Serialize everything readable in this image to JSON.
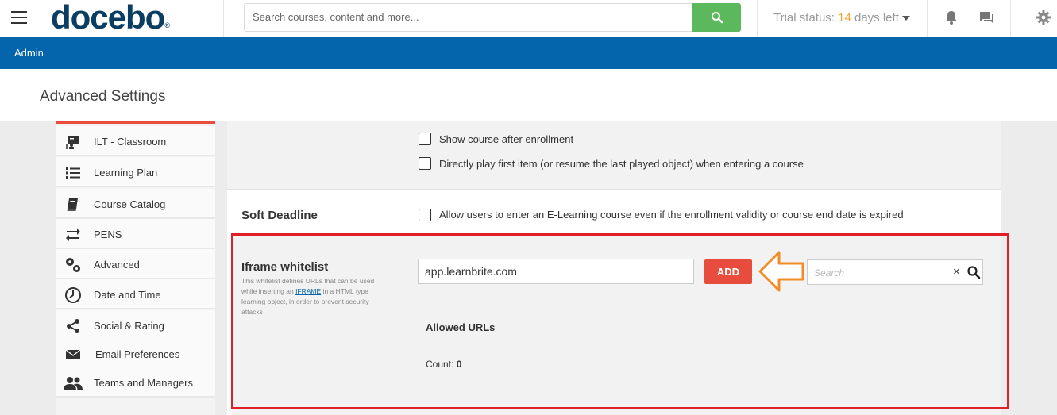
{
  "header": {
    "logo": "docebo",
    "logo_mark": "®",
    "search_placeholder": "Search courses, content and more...",
    "trial_prefix": "Trial status:",
    "trial_days": "14",
    "trial_suffix": "days left"
  },
  "adminbar": {
    "label": "Admin"
  },
  "page": {
    "title": "Advanced Settings"
  },
  "sidebar": {
    "items": [
      {
        "label": "ILT - Classroom",
        "icon": "classroom-icon"
      },
      {
        "label": "Learning Plan",
        "icon": "list-icon"
      },
      {
        "label": "Course Catalog",
        "icon": "book-icon"
      },
      {
        "label": "PENS",
        "icon": "swap-arrows-icon"
      },
      {
        "label": "Advanced",
        "icon": "gears-icon"
      },
      {
        "label": "Date and Time",
        "icon": "clock-icon"
      },
      {
        "label": "Social & Rating",
        "icon": "share-icon"
      },
      {
        "label": "Email Preferences",
        "icon": "envelope-icon"
      },
      {
        "label": "Teams and Managers",
        "icon": "users-icon"
      }
    ]
  },
  "content": {
    "options": [
      {
        "label": "Show course after enrollment",
        "checked": false
      },
      {
        "label": "Directly play first item (or resume the last played object) when entering a course",
        "checked": false
      }
    ],
    "soft_deadline": {
      "title": "Soft Deadline",
      "label": "Allow users to enter an E-Learning course even if the enrollment validity or course end date is expired",
      "checked": false
    },
    "iframe": {
      "title": "Iframe whitelist",
      "desc_before": "This whitelist defines URLs that can be used while inserting an",
      "desc_link": "IFRAME",
      "desc_after": "in a HTML type learning object, in order to prevent security attacks",
      "input_value": "app.learnbrite.com",
      "add_label": "ADD",
      "search_placeholder": "Search",
      "clear_glyph": "×",
      "allowed_title": "Allowed URLs",
      "count_label": "Count:",
      "count_value": "0"
    }
  },
  "colors": {
    "brand_blue": "#0465ac",
    "search_green": "#5cb85c",
    "add_red": "#e74c3c",
    "highlight_red": "#e01f26",
    "arrow_orange": "#f28c28",
    "trial_orange": "#f0a33a"
  }
}
